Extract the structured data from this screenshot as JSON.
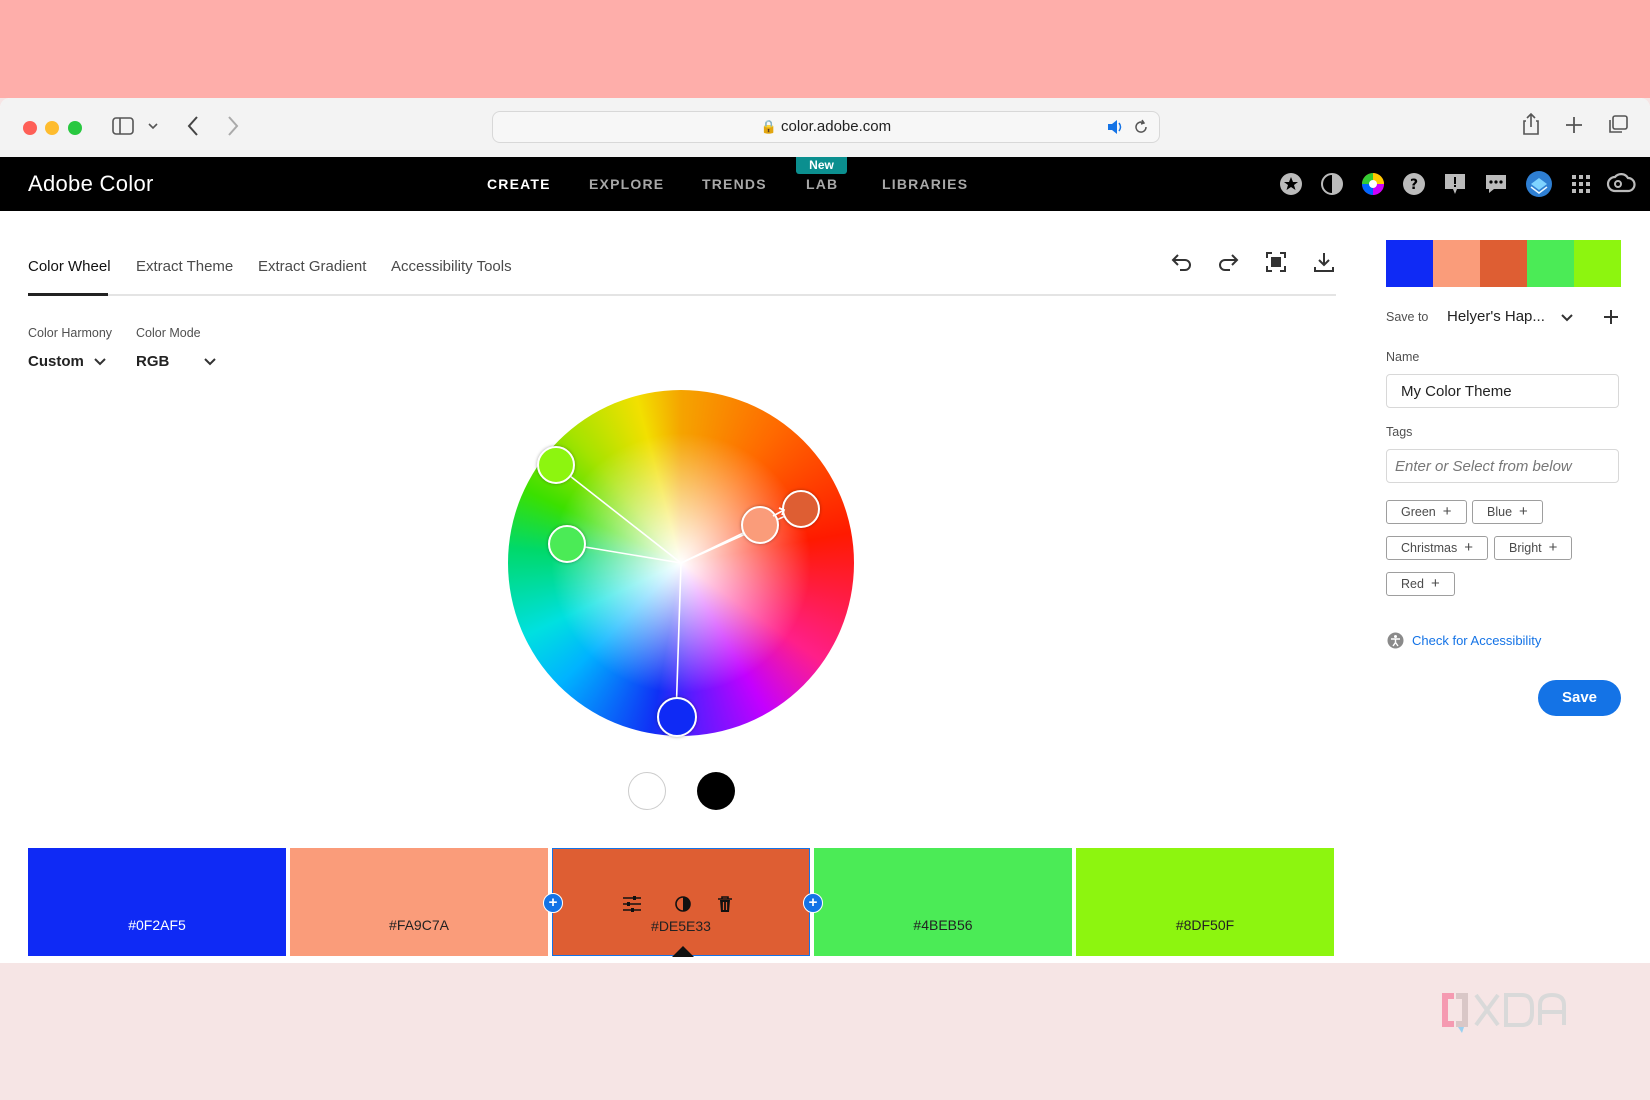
{
  "browser": {
    "url": "color.adobe.com"
  },
  "app": {
    "brand": "Adobe Color",
    "nav": [
      {
        "label": "CREATE",
        "active": true
      },
      {
        "label": "EXPLORE"
      },
      {
        "label": "TRENDS"
      },
      {
        "label": "LAB",
        "badge": "New"
      },
      {
        "label": "LIBRARIES"
      }
    ],
    "right_icons": [
      "star-icon",
      "contrast-icon",
      "color-wheel-icon",
      "help-icon",
      "feedback-icon",
      "chat-icon",
      "avatar",
      "apps-grid-icon",
      "creative-cloud-icon"
    ]
  },
  "tabs": [
    {
      "label": "Color Wheel",
      "active": true
    },
    {
      "label": "Extract Theme"
    },
    {
      "label": "Extract Gradient"
    },
    {
      "label": "Accessibility Tools"
    }
  ],
  "toolbar_icons": [
    "undo-icon",
    "redo-icon",
    "fullscreen-icon",
    "download-icon"
  ],
  "controls": {
    "harmony_label": "Color Harmony",
    "harmony_value": "Custom",
    "mode_label": "Color Mode",
    "mode_value": "RGB"
  },
  "swatches": [
    {
      "hex": "#0F2AF5",
      "color": "#0F2AF5",
      "text_color": "#ffffff"
    },
    {
      "hex": "#FA9C7A",
      "color": "#FA9C7A",
      "text_color": "#222222"
    },
    {
      "hex": "#DE5E33",
      "color": "#DE5E33",
      "text_color": "#222222",
      "selected": true
    },
    {
      "hex": "#4BEB56",
      "color": "#4BEB56",
      "text_color": "#222222"
    },
    {
      "hex": "#8DF50F",
      "color": "#8DF50F",
      "text_color": "#222222"
    }
  ],
  "panel": {
    "save_to_label": "Save to",
    "save_to_value": "Helyer's Hap...",
    "name_label": "Name",
    "name_value": "My Color Theme",
    "tags_label": "Tags",
    "tags_placeholder": "Enter or Select from below",
    "tags": [
      "Green",
      "Blue",
      "Christmas",
      "Bright",
      "Red"
    ],
    "accessibility_link": "Check for Accessibility",
    "save_button": "Save"
  },
  "watermark": "XDA",
  "accent_color": "#1473e6"
}
